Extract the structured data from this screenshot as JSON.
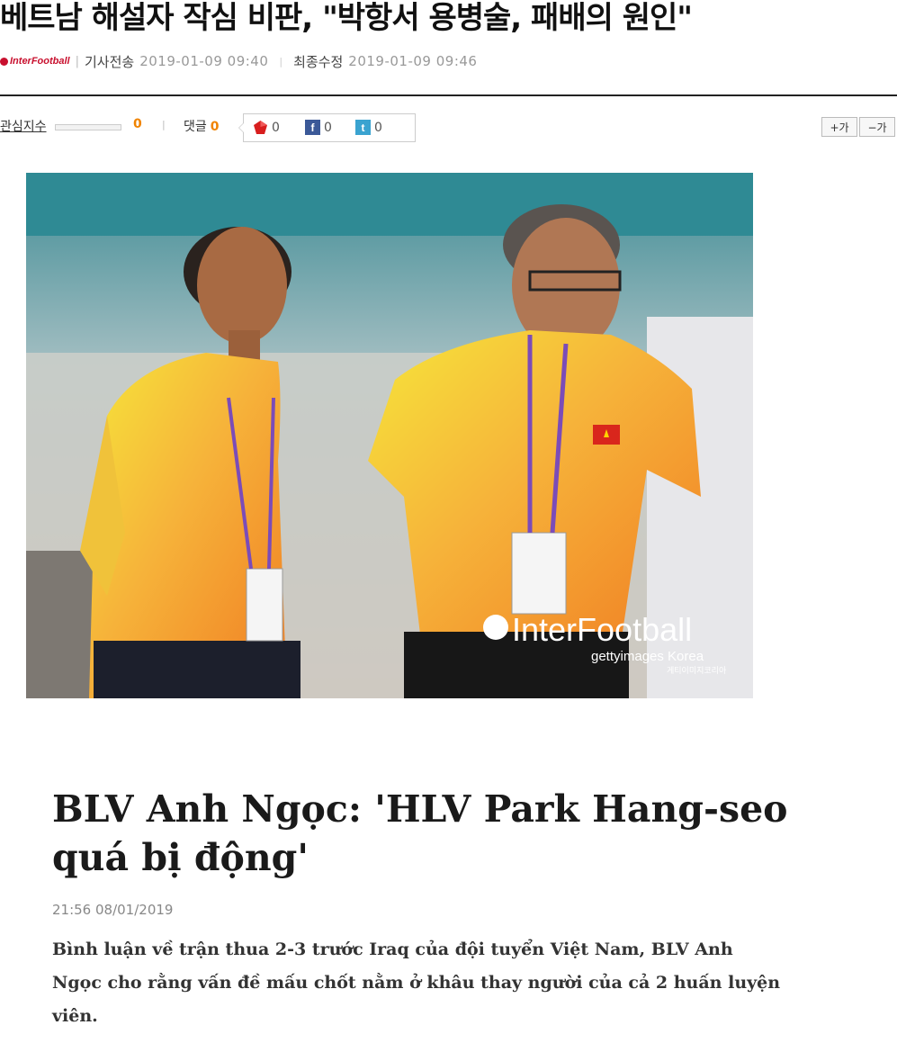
{
  "article": {
    "headline": "베트남 해설자 작심 비판, \"박항서 용병술, 패배의 원인\"",
    "source_logo_text": "InterFootball",
    "sent_label": "기사전송",
    "sent_date": "2019-01-09 09:40",
    "modified_label": "최종수정",
    "modified_date": "2019-01-09 09:46"
  },
  "toolbar": {
    "interest_label": "관심지수",
    "interest_count": "0",
    "comments_label": "댓글",
    "comments_count": "0",
    "shares": [
      {
        "icon": "red-gem-icon",
        "count": "0"
      },
      {
        "icon": "facebook-icon",
        "glyph": "f",
        "count": "0"
      },
      {
        "icon": "twitter-icon",
        "glyph": "t",
        "count": "0"
      }
    ],
    "font_increase_label": "+가",
    "font_decrease_label": "−가"
  },
  "photo": {
    "watermark": "InterFootball",
    "credit": "gettyimages Korea",
    "credit_sub": "게티이미지코리아"
  },
  "embedded_card": {
    "title": "BLV Anh Ngọc: 'HLV Park Hang-seo quá bị động'",
    "timestamp": "21:56 08/01/2019",
    "summary": "Bình luận về trận thua 2-3 trước Iraq của đội tuyển Việt Nam, BLV Anh Ngọc cho rằng vấn đề mấu chốt nằm ở khâu thay người của cả 2 huấn luyện viên."
  },
  "colors": {
    "accent_orange": "#f08300",
    "brand_red": "#c8102e",
    "facebook_blue": "#3b5998",
    "twitter_blue": "#3aa3d0"
  }
}
